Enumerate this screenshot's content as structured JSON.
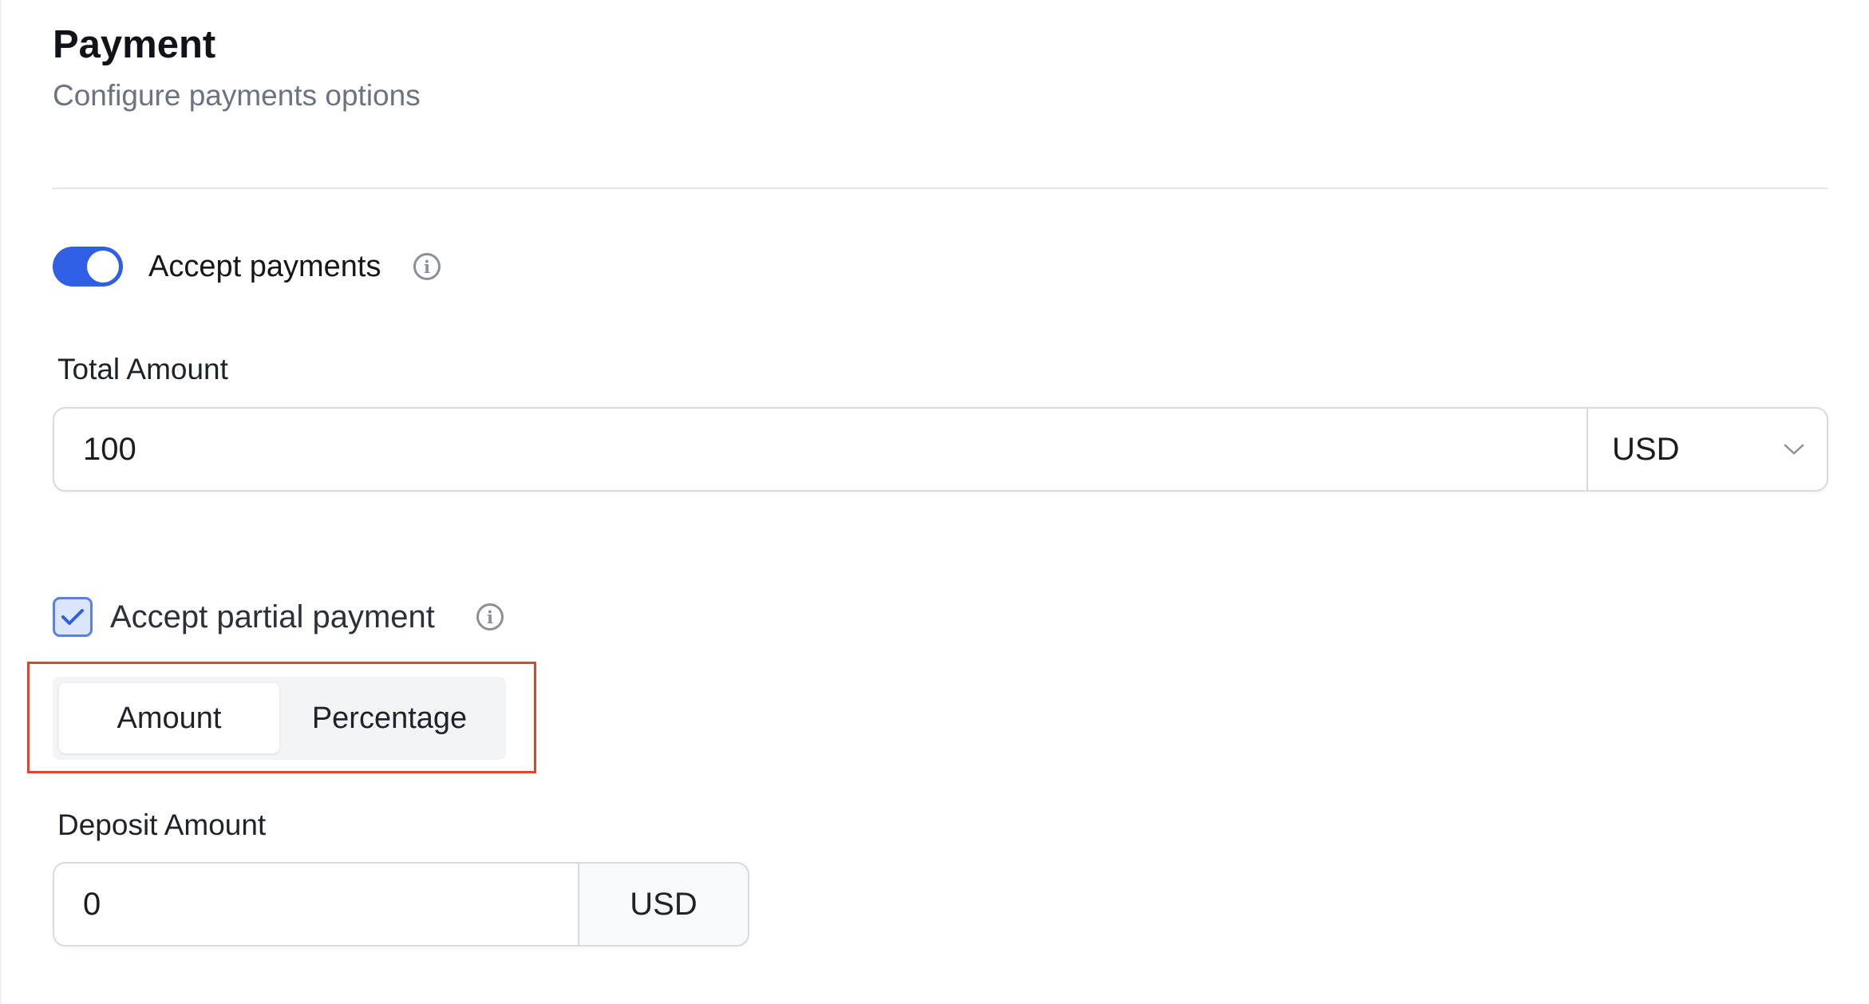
{
  "header": {
    "title": "Payment",
    "subtitle": "Configure payments options"
  },
  "accept_payments": {
    "label": "Accept payments",
    "enabled": true,
    "info_icon": "info-icon"
  },
  "total_amount": {
    "label": "Total Amount",
    "value": "100",
    "currency": "USD",
    "dropdown_icon": "chevron-down-icon"
  },
  "partial_payment": {
    "label": "Accept partial payment",
    "checked": true,
    "info_icon": "info-icon",
    "mode_options": [
      "Amount",
      "Percentage"
    ],
    "selected_mode": "Amount"
  },
  "deposit_amount": {
    "label": "Deposit Amount",
    "value": "0",
    "currency": "USD"
  },
  "colors": {
    "accent": "#2f5fe4",
    "highlight_border": "#e0452b",
    "muted_text": "#6b7280"
  }
}
